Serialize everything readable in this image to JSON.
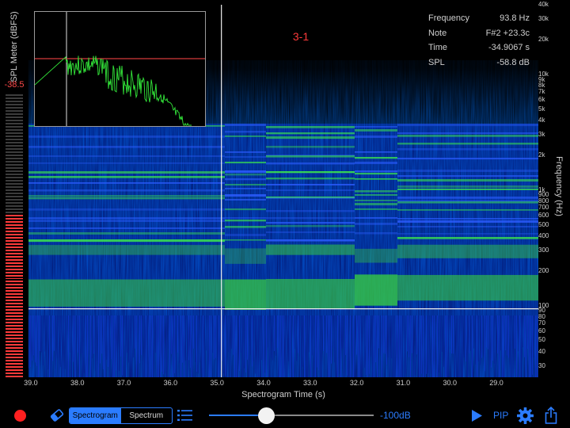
{
  "spl": {
    "label": "SPL Meter (dBFS)",
    "value": "-38.5",
    "segments_total": 90,
    "segments_lit": 52
  },
  "readout": {
    "rows": [
      {
        "key": "Frequency",
        "value": "93.8 Hz"
      },
      {
        "key": "Note",
        "value": "F#2 +23.3c"
      },
      {
        "key": "Time",
        "value": "-34.9067 s"
      },
      {
        "key": "SPL",
        "value": "-58.8 dB"
      }
    ]
  },
  "bookmark": "3-1",
  "frequency_axis": {
    "title": "Frequency (Hz)",
    "ticks": [
      "40k",
      "30k",
      "20k",
      "10k",
      "9k",
      "8k",
      "7k",
      "6k",
      "5k",
      "4k",
      "3k",
      "2k",
      "1k",
      "900",
      "800",
      "700",
      "600",
      "500",
      "400",
      "300",
      "200",
      "100",
      "90",
      "80",
      "70",
      "60",
      "50",
      "40",
      "30"
    ]
  },
  "time_axis": {
    "title": "Spectrogram Time (s)",
    "ticks": [
      "39.0",
      "38.0",
      "37.0",
      "36.0",
      "35.0",
      "34.0",
      "33.0",
      "32.0",
      "31.0",
      "30.0",
      "29.0"
    ]
  },
  "cursor": {
    "time": -34.9067,
    "frequency": 93.8
  },
  "toolbar": {
    "tab_spectrogram": "Spectrogram",
    "tab_spectrum": "Spectrum",
    "range_label": "-100dB",
    "pip_label": "PIP",
    "slider_fraction": 0.35
  },
  "colors": {
    "accent": "#2b7cff",
    "record": "#ff2020",
    "spectrum_line": "#33e83a",
    "threshold": "#d23a3a"
  },
  "icons": [
    "record-icon",
    "eraser-icon",
    "list-icon",
    "play-icon",
    "gear-icon",
    "share-icon"
  ]
}
